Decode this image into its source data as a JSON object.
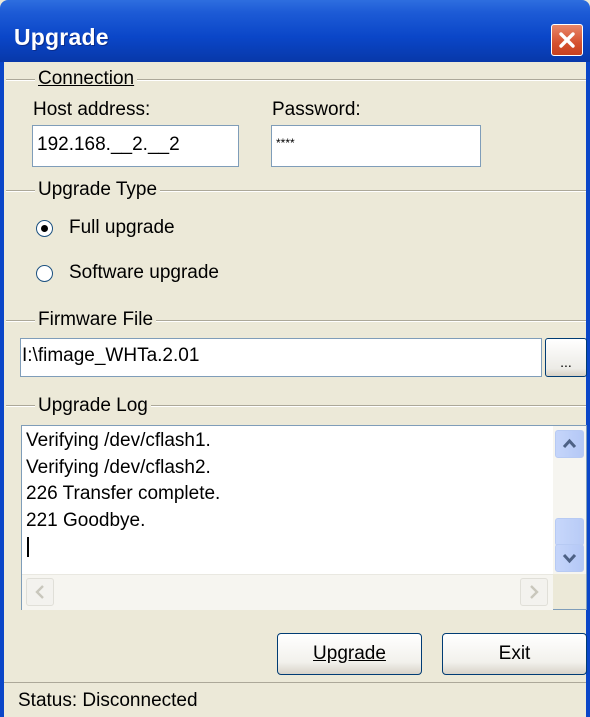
{
  "window": {
    "title": "Upgrade"
  },
  "connection": {
    "group_label": "Connection",
    "host_label": "Host address:",
    "host_value": "192.168.__2.__2",
    "password_label": "Password:",
    "password_value": "****"
  },
  "upgrade_type": {
    "group_label": "Upgrade Type",
    "options": [
      {
        "label": "Full upgrade",
        "selected": true
      },
      {
        "label": "Software upgrade",
        "selected": false
      }
    ]
  },
  "firmware": {
    "group_label": "Firmware File",
    "path": "I:\\fimage_WHTa.2.01",
    "browse_label": "..."
  },
  "log": {
    "group_label": "Upgrade Log",
    "lines": [
      "Verifying /dev/cflash1.",
      "Verifying /dev/cflash2.",
      "226 Transfer complete.",
      "221 Goodbye."
    ]
  },
  "buttons": {
    "upgrade": "Upgrade",
    "exit": "Exit"
  },
  "status": {
    "text": "Status: Disconnected"
  },
  "colors": {
    "title_bar": "#0A46C8",
    "dialog_bg": "#ECE9D8",
    "close_button": "#D5512F"
  }
}
